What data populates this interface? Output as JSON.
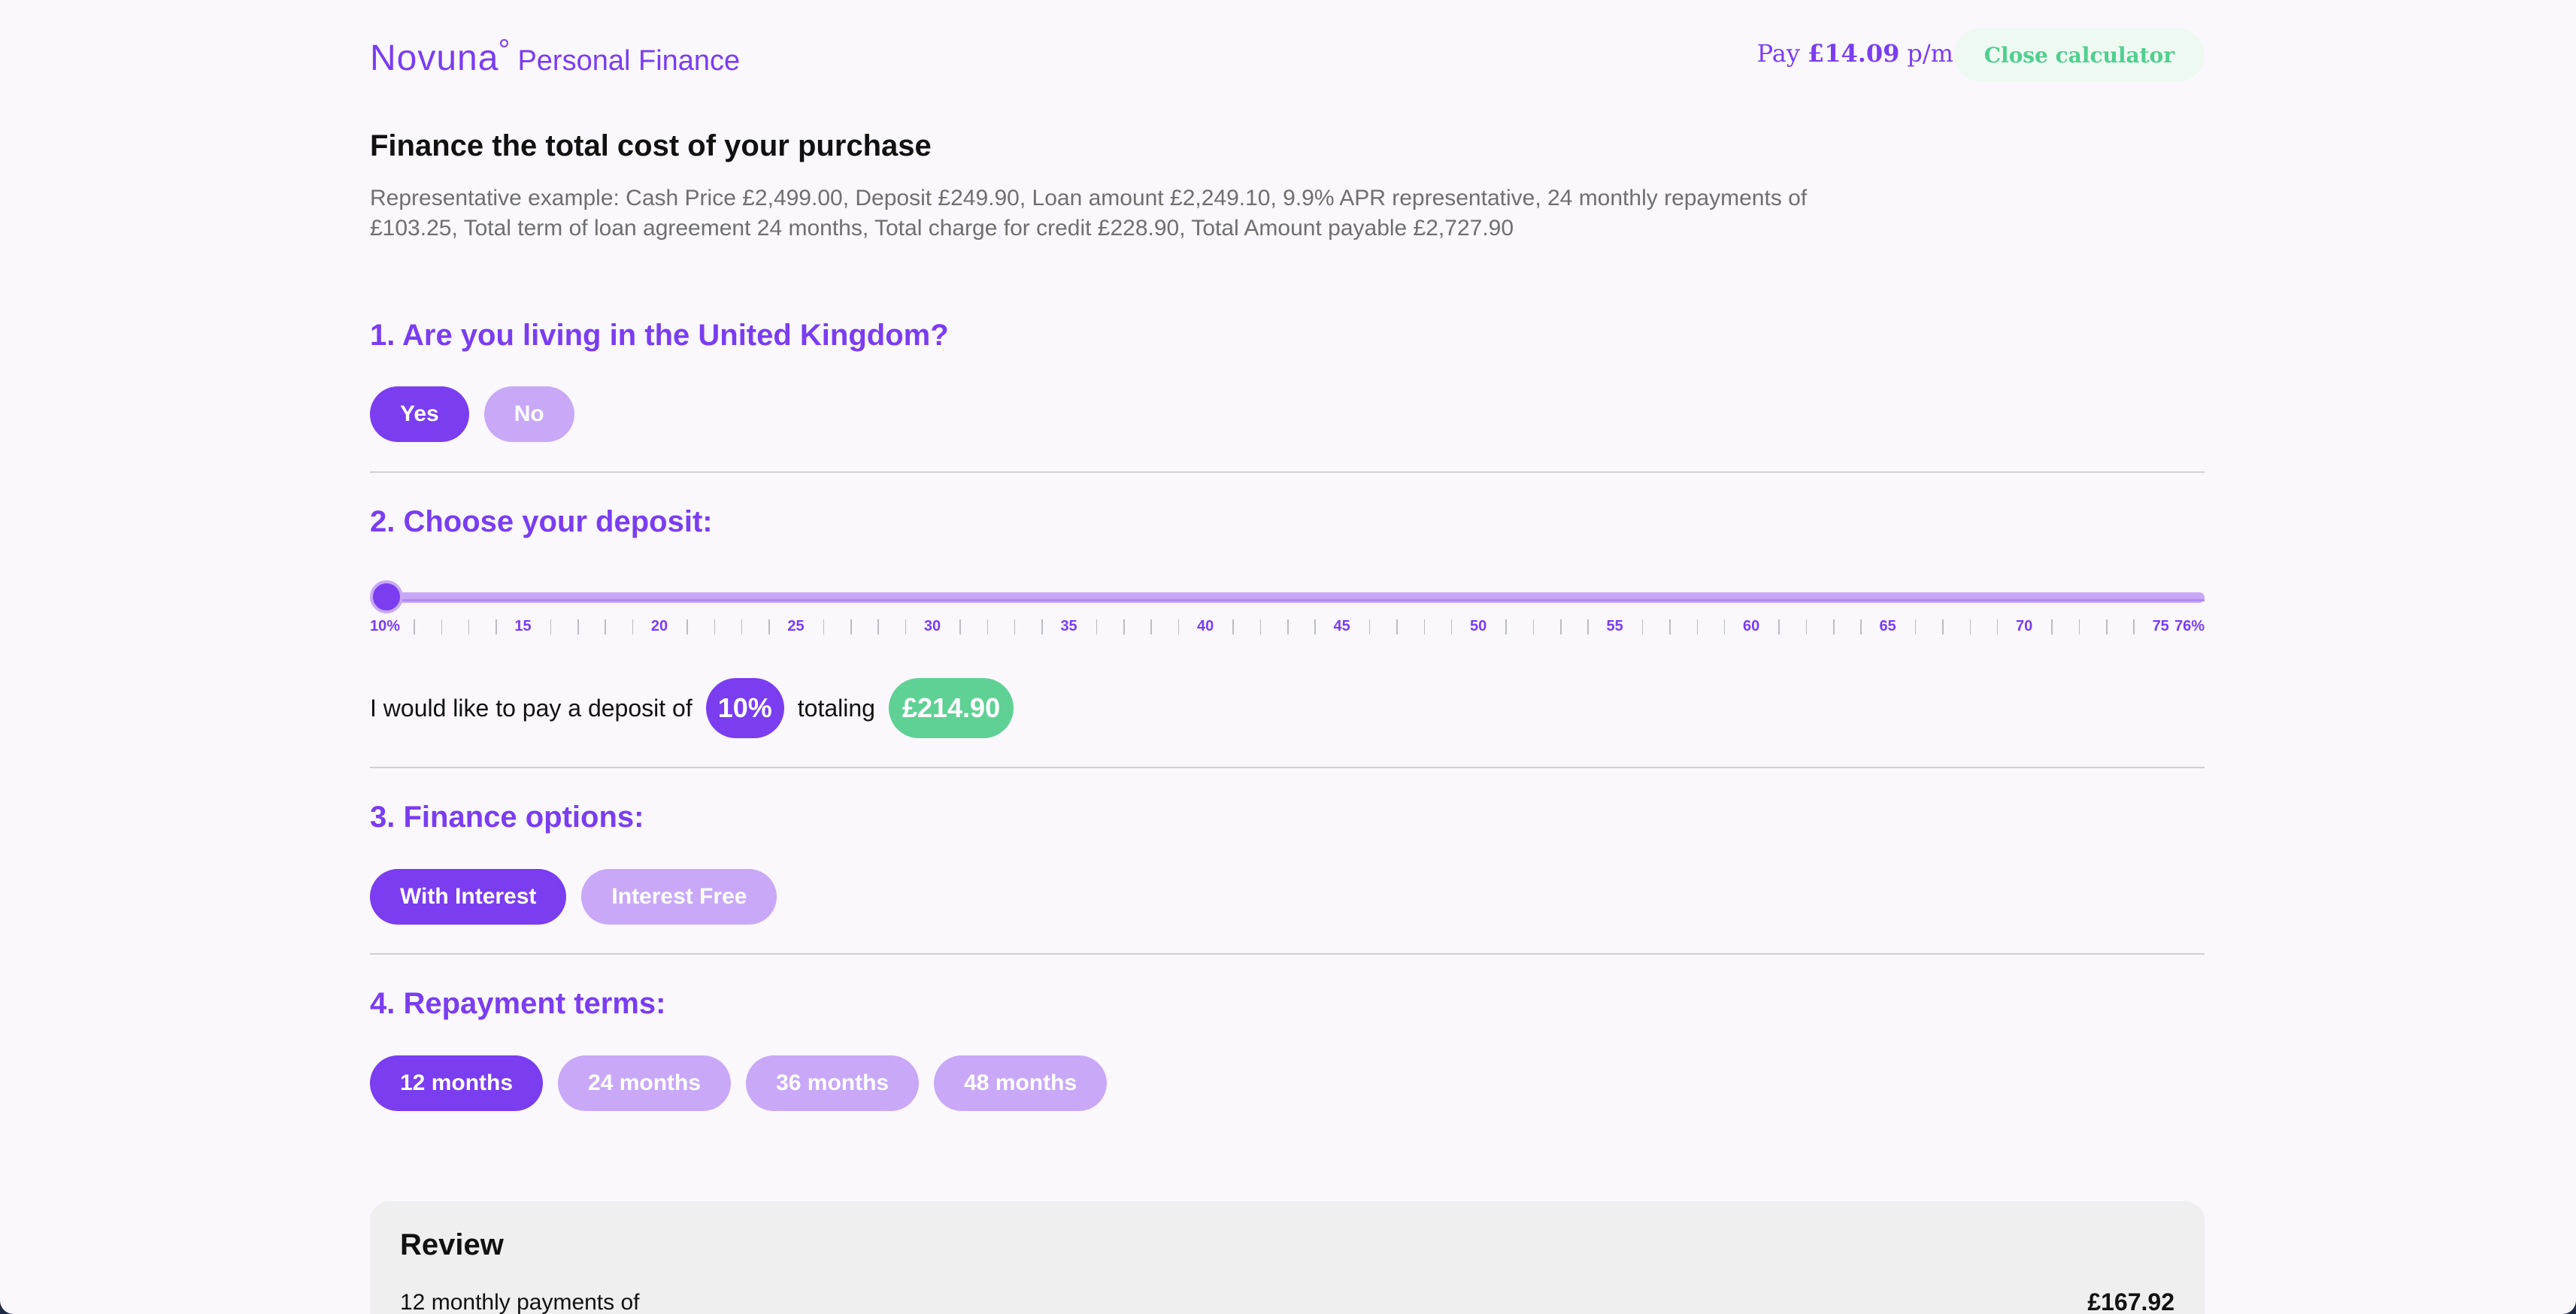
{
  "header": {
    "logo_word": "Novuna",
    "logo_sub": "Personal Finance",
    "pay_prefix": "Pay",
    "pay_amount": "£14.09",
    "pay_suffix": "p/m",
    "close_label": "Close calculator"
  },
  "title": "Finance the total cost of your purchase",
  "representative_example": "Representative example: Cash Price £2,499.00, Deposit £249.90, Loan amount £2,249.10, 9.9% APR representative, 24 monthly repayments of £103.25, Total term of loan agreement 24 months, Total charge for credit £228.90, Total Amount payable £2,727.90",
  "q1": {
    "title": "1. Are you living in the United Kingdom?",
    "options": [
      "Yes",
      "No"
    ],
    "selected": "Yes"
  },
  "q2": {
    "title": "2. Choose your deposit:",
    "slider": {
      "min": 10,
      "max": 76,
      "value": 10,
      "labels": [
        "10%",
        "15",
        "20",
        "25",
        "30",
        "35",
        "40",
        "45",
        "50",
        "55",
        "60",
        "65",
        "70",
        "75",
        "76%"
      ]
    },
    "sentence_start": "I would like to pay a deposit of",
    "percent": "10%",
    "sentence_mid": "totaling",
    "amount": "£214.90"
  },
  "q3": {
    "title": "3. Finance options:",
    "options": [
      "With Interest",
      "Interest Free"
    ],
    "selected": "With Interest"
  },
  "q4": {
    "title": "4. Repayment terms:",
    "options": [
      "12 months",
      "24 months",
      "36 months",
      "48 months"
    ],
    "selected": "12 months"
  },
  "review": {
    "title": "Review",
    "row_label": "12 monthly payments of",
    "row_value": "£167.92"
  },
  "colors": {
    "brand_purple": "#7a3df0",
    "light_purple": "#c9a8f7",
    "green": "#5fd194",
    "background": "#faf7fd"
  }
}
